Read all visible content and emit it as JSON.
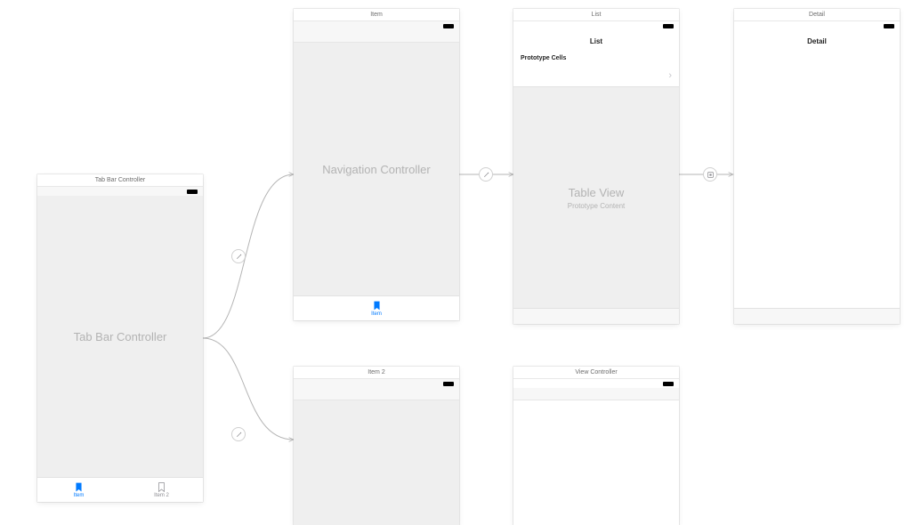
{
  "scenes": {
    "tabbar": {
      "title": "Tab Bar Controller",
      "placeholder": "Tab Bar Controller",
      "tabs": [
        {
          "label": "Item",
          "active": true
        },
        {
          "label": "Item 2",
          "active": false
        }
      ]
    },
    "item": {
      "title": "Item",
      "placeholder": "Navigation Controller",
      "tab_label": "Item"
    },
    "list": {
      "title": "List",
      "nav_title": "List",
      "section_header": "Prototype Cells",
      "table_placeholder": "Table View",
      "table_subtitle": "Prototype Content"
    },
    "detail": {
      "title": "Detail",
      "nav_title": "Detail"
    },
    "item2": {
      "title": "Item 2"
    },
    "vc": {
      "title": "View Controller"
    }
  },
  "chevron": "›"
}
